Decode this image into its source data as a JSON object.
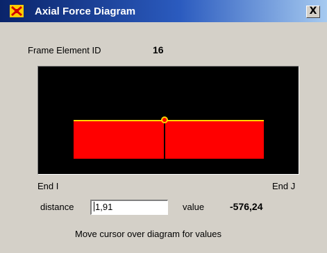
{
  "window": {
    "title": "Axial Force Diagram",
    "close_label": "X",
    "icon": "sap-app-icon"
  },
  "frame": {
    "label": "Frame Element ID",
    "value": "16"
  },
  "diagram": {
    "end_i_label": "End I",
    "end_j_label": "End J",
    "colors": {
      "background": "#000000",
      "force": "#ff0000",
      "outline": "#ffd700"
    }
  },
  "readout": {
    "distance_label": "distance",
    "distance_value": "1,91",
    "value_label": "value",
    "value": "-576,24"
  },
  "hint": "Move cursor over diagram for values"
}
